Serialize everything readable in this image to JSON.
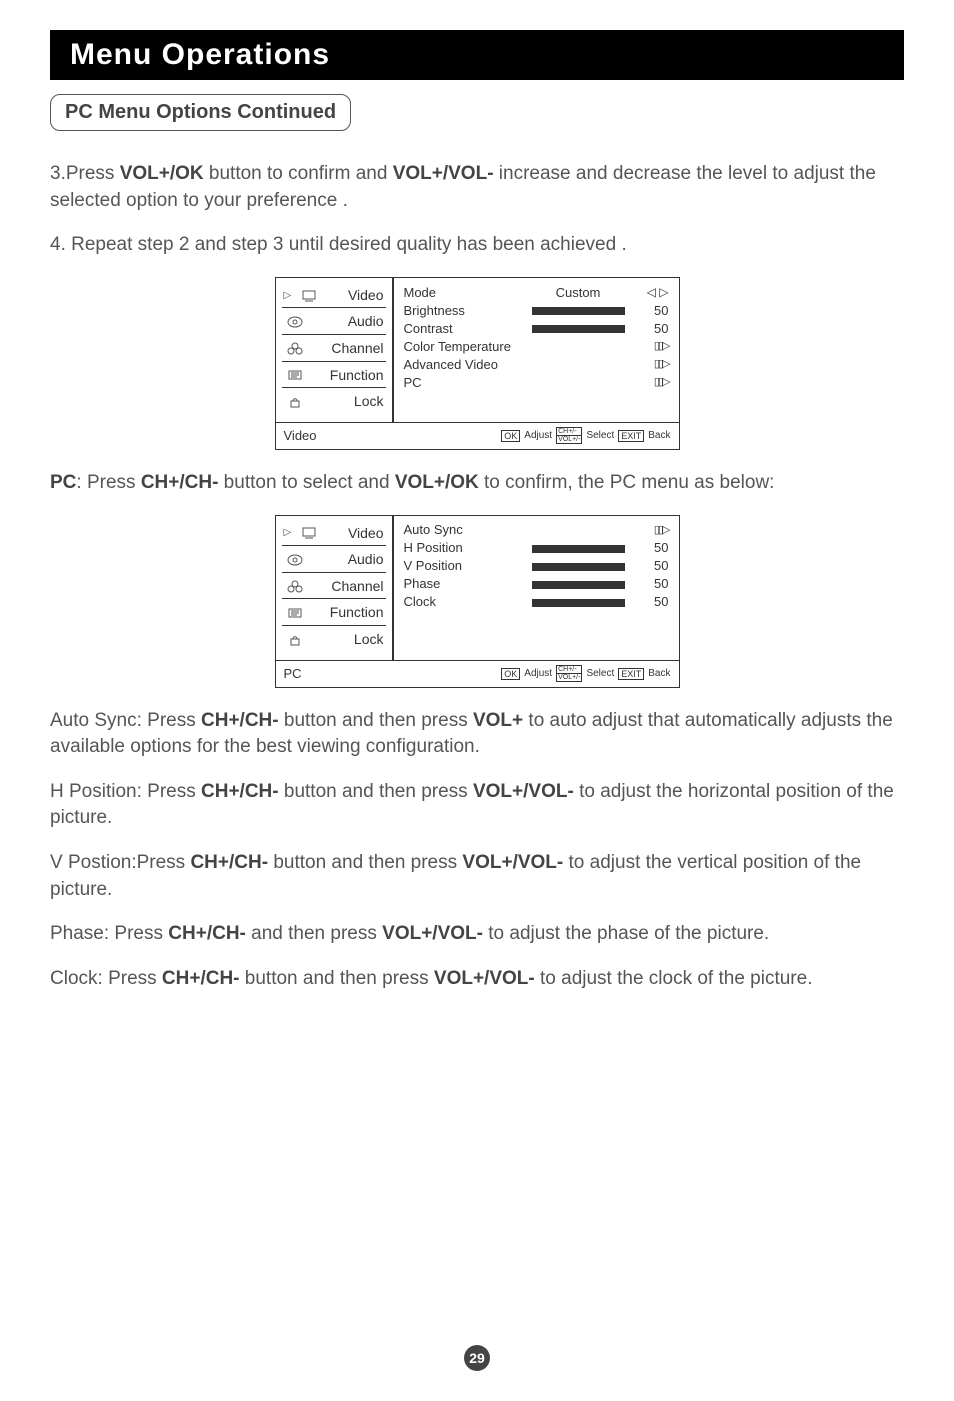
{
  "title": "Menu Operations",
  "subtitle": "PC Menu Options Continued",
  "step3_pre": "3.Press ",
  "step3_b1": "VOL+/OK",
  "step3_mid": " button to confirm and ",
  "step3_b2": "VOL+/VOL-",
  "step3_post": " increase and decrease the level to adjust the selected option to your preference .",
  "step4": "4. Repeat step 2 and step 3 until desired quality has been achieved .",
  "osd_tabs": {
    "video": "Video",
    "audio": "Audio",
    "channel": "Channel",
    "function": "Function",
    "lock": "Lock"
  },
  "osd1": {
    "mode_label": "Mode",
    "mode_value": "Custom",
    "brightness_label": "Brightness",
    "brightness_value": "50",
    "contrast_label": "Contrast",
    "contrast_value": "50",
    "color_temp_label": "Color Temperature",
    "adv_video_label": "Advanced Video",
    "pc_label": "PC",
    "footer_left": "Video",
    "footer_ok": "OK",
    "footer_adjust": "Adjust",
    "footer_ch1": "CH+/-",
    "footer_ch2": "VOL+/-",
    "footer_select": "Select",
    "footer_exit": "EXIT",
    "footer_back": "Back"
  },
  "pc_intro_pre": "PC",
  "pc_intro_mid1": ": Press ",
  "pc_intro_b1": "CH+/CH-",
  "pc_intro_mid2": " button to select and ",
  "pc_intro_b2": "VOL+/OK",
  "pc_intro_post": " to confirm, the PC menu as below:",
  "osd2": {
    "autosync_label": "Auto Sync",
    "hpos_label": "H Position",
    "hpos_value": "50",
    "vpos_label": "V Position",
    "vpos_value": "50",
    "phase_label": "Phase",
    "phase_value": "50",
    "clock_label": "Clock",
    "clock_value": "50",
    "footer_left": "PC",
    "footer_ok": "OK",
    "footer_adjust": "Adjust",
    "footer_ch1": "CH+/-",
    "footer_ch2": "VOL+/-",
    "footer_select": "Select",
    "footer_exit": "EXIT",
    "footer_back": "Back"
  },
  "autosync_pre": "Auto Sync: Press ",
  "autosync_b1": "CH+/CH-",
  "autosync_mid": " button and then press ",
  "autosync_b2": "VOL+",
  "autosync_post": " to auto adjust that automatically adjusts the available options for the best viewing configuration.",
  "hpos_pre": "H Position: Press ",
  "hpos_b1": "CH+/CH-",
  "hpos_mid": " button and then press ",
  "hpos_b2": "VOL+/VOL-",
  "hpos_post": " to adjust the horizontal position of the picture.",
  "vpos_pre": "V Postion:Press ",
  "vpos_b1": "CH+/CH-",
  "vpos_mid": " button and then press ",
  "vpos_b2": "VOL+/VOL-",
  "vpos_post": " to adjust the vertical position of the picture.",
  "phase_pre": "Phase: Press ",
  "phase_b1": "CH+/CH-",
  "phase_mid": " and then press ",
  "phase_b2": "VOL+/VOL-",
  "phase_post": " to adjust the phase of the picture.",
  "clock_pre": "Clock: Press ",
  "clock_b1": "CH+/CH-",
  "clock_mid": " button and then press ",
  "clock_b2": "VOL+/VOL-",
  "clock_post": " to adjust the clock of the picture.",
  "page_number": "29",
  "glyphs": {
    "diamond": "◁ ▷",
    "tri": "▯▯▷"
  }
}
